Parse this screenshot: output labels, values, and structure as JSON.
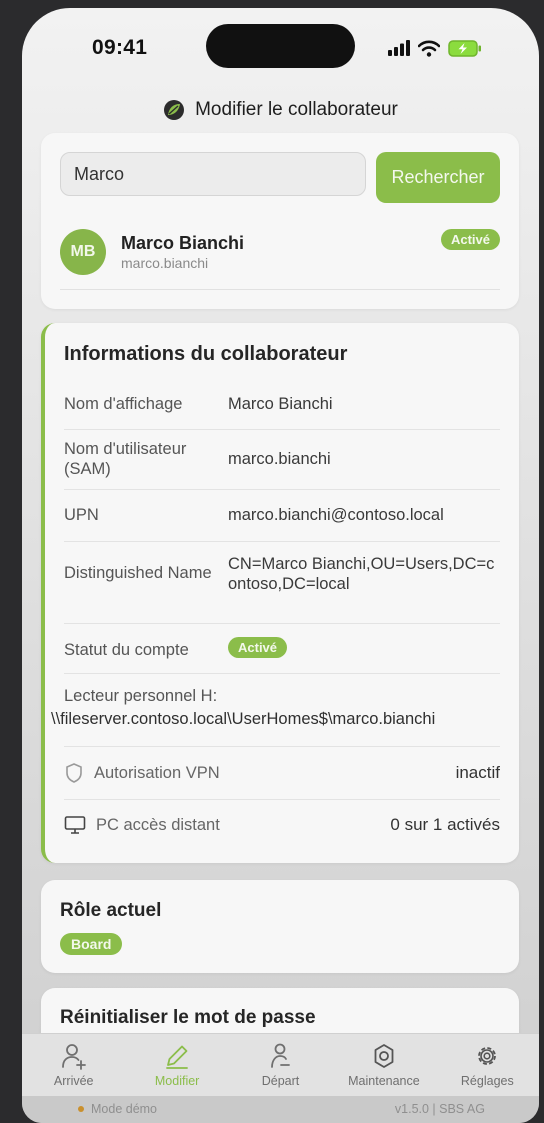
{
  "status_bar": {
    "time": "09:41"
  },
  "header": {
    "title": "Modifier le collaborateur"
  },
  "search": {
    "value": "Marco",
    "placeholder": "",
    "button_label": "Rechercher",
    "result": {
      "initials": "MB",
      "name": "Marco Bianchi",
      "username": "marco.bianchi",
      "status": "Activé"
    }
  },
  "info": {
    "title": "Informations du collaborateur",
    "rows": [
      {
        "label": "Nom d'affichage",
        "value": "Marco Bianchi"
      },
      {
        "label": "Nom d'utilisateur (SAM)",
        "value": "marco.bianchi"
      },
      {
        "label": "UPN",
        "value": "marco.bianchi@contoso.local"
      },
      {
        "label": "Distinguished Name",
        "value": "CN=Marco Bianchi,OU=Users,DC=contoso,DC=local"
      },
      {
        "label": "Statut du compte",
        "value": "Activé"
      }
    ],
    "drive_label": "Lecteur personnel H:",
    "drive_value": "\\\\fileserver.contoso.local\\UserHomes$\\marco.bianchi",
    "vpn": {
      "label": "Autorisation VPN",
      "value": "inactif"
    },
    "remote_pc": {
      "label": "PC accès distant",
      "value": "0 sur 1 activés"
    }
  },
  "role": {
    "title": "Rôle actuel",
    "badge": "Board"
  },
  "password": {
    "title": "Réinitialiser le mot de passe"
  },
  "tabs": [
    {
      "label": "Arrivée",
      "icon": "user-plus-icon"
    },
    {
      "label": "Modifier",
      "icon": "pencil-icon"
    },
    {
      "label": "Départ",
      "icon": "user-minus-icon"
    },
    {
      "label": "Maintenance",
      "icon": "gear-icon"
    },
    {
      "label": "Réglages",
      "icon": "cog-icon"
    }
  ],
  "active_tab": "Modifier",
  "footer": {
    "mode": "Mode démo",
    "version": "v1.5.0 | SBS AG"
  },
  "colors": {
    "accent": "#8bbd4a",
    "background": "#2b2b2d"
  }
}
